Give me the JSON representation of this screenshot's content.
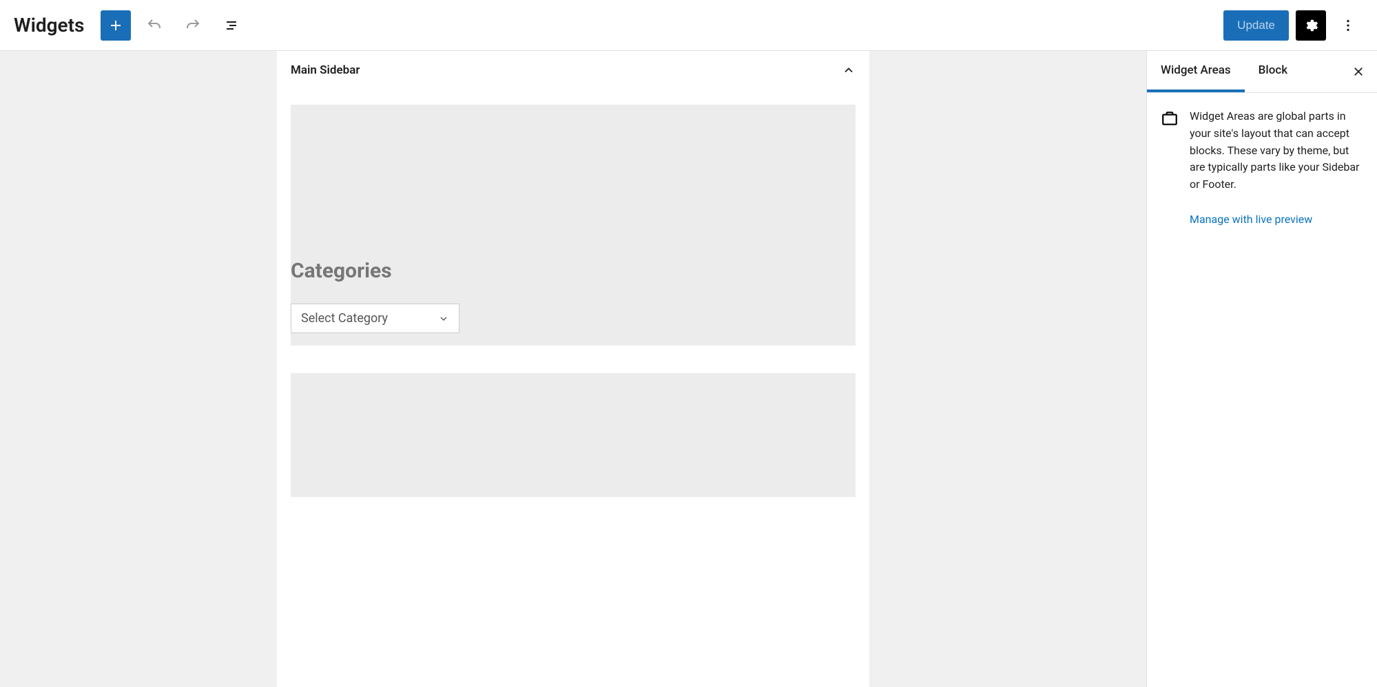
{
  "header": {
    "title": "Widgets",
    "update_label": "Update"
  },
  "main": {
    "panel_title": "Main Sidebar",
    "categories_heading": "Categories",
    "categories_select_label": "Select Category"
  },
  "sidebar": {
    "tabs": {
      "widget_areas": "Widget Areas",
      "block": "Block"
    },
    "description": "Widget Areas are global parts in your site's layout that can accept blocks. These vary by theme, but are typically parts like your Sidebar or Footer.",
    "manage_link_label": "Manage with live preview"
  }
}
